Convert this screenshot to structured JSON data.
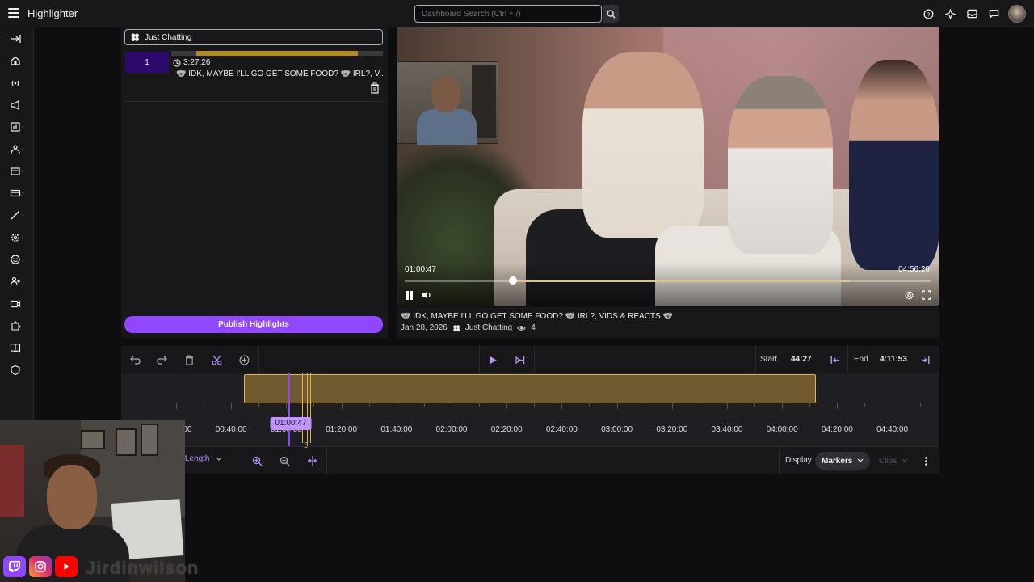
{
  "app": {
    "title": "Highlighter"
  },
  "search": {
    "placeholder": "Dashboard Search (Ctrl + /)"
  },
  "top_icons": [
    "help-icon",
    "sparkle-icon",
    "inbox-icon",
    "whispers-icon",
    "avatar"
  ],
  "sidebar": {
    "items": [
      {
        "icon": "collapse-icon",
        "expandable": false
      },
      {
        "icon": "home-icon",
        "expandable": false
      },
      {
        "icon": "broadcast-icon",
        "expandable": false
      },
      {
        "icon": "megaphone-icon",
        "expandable": false
      },
      {
        "icon": "analytics-icon",
        "expandable": true
      },
      {
        "icon": "community-icon",
        "expandable": true
      },
      {
        "icon": "content-icon",
        "expandable": true
      },
      {
        "icon": "monetization-icon",
        "expandable": true
      },
      {
        "icon": "customization-icon",
        "expandable": true
      },
      {
        "icon": "settings-icon",
        "expandable": true
      },
      {
        "icon": "emote-icon",
        "expandable": true
      },
      {
        "icon": "add-user-icon",
        "expandable": false
      },
      {
        "icon": "video-icon",
        "expandable": false
      },
      {
        "icon": "extensions-icon",
        "expandable": false
      },
      {
        "icon": "book-icon",
        "expandable": false
      },
      {
        "icon": "shield-icon",
        "expandable": false
      }
    ]
  },
  "highlights": {
    "category": "Just Chatting",
    "items": [
      {
        "number": "1",
        "duration": "3:27:26",
        "title": "🐨 IDK, MAYBE I'LL GO GET SOME FOOD? 🐨 IRL?, V...",
        "bar_start": 0.12,
        "bar_end": 0.88
      }
    ],
    "publish_label": "Publish Highlights"
  },
  "player": {
    "current_time": "01:00:47",
    "end_time": "04:56:20",
    "progress": 0.205,
    "buffered_end": 0.847
  },
  "video_info": {
    "title": "🐨 IDK, MAYBE I'LL GO GET SOME FOOD? 🐨 IRL?, VIDS & REACTS 🐨",
    "date": "Jan 28, 2026",
    "category": "Just Chatting",
    "views": "4"
  },
  "timeline": {
    "start_label": "Start",
    "start_value": "44:27",
    "end_label": "End",
    "end_value": "4:11:53",
    "playhead_time": "01:00:47",
    "ticks": [
      "00:20:00",
      "00:40:00",
      "01:00:00",
      "01:20:00",
      "01:40:00",
      "02:00:00",
      "02:20:00",
      "02:40:00",
      "03:00:00",
      "03:20:00",
      "03:40:00",
      "04:00:00",
      "04:20:00",
      "04:40:00"
    ],
    "marker_count": "3",
    "zoom_label": "Full Length",
    "display_label": "Display",
    "markers_label": "Markers",
    "clips_label": "Clips"
  },
  "socials": {
    "handle": "Jirdinwilson"
  },
  "colors": {
    "accent": "#9147ff",
    "clip": "#6f5a32",
    "clip_border": "#e3b341",
    "highlight_number_bg": "#2b0a6b"
  }
}
